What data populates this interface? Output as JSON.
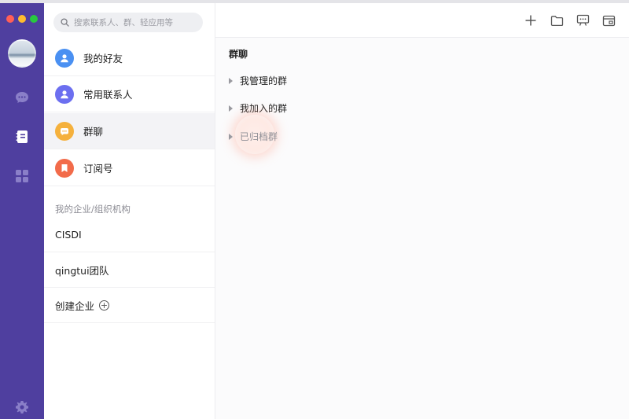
{
  "search": {
    "placeholder": "搜索联系人、群、轻应用等"
  },
  "rail": {
    "items": [
      {
        "name": "chat",
        "icon": "chat-bubble-icon"
      },
      {
        "name": "contacts",
        "icon": "contacts-book-icon",
        "active": true
      },
      {
        "name": "apps",
        "icon": "grid-icon"
      }
    ],
    "settings_icon": "gear-icon"
  },
  "sidebar": {
    "items": [
      {
        "label": "我的好友",
        "icon": "person-icon",
        "color": "#4a90f2"
      },
      {
        "label": "常用联系人",
        "icon": "person-icon",
        "color": "#6c6ff0"
      },
      {
        "label": "群聊",
        "icon": "group-chat-icon",
        "color": "#f5b13d",
        "active": true
      },
      {
        "label": "订阅号",
        "icon": "bookmark-icon",
        "color": "#f26b4a"
      }
    ],
    "org_section_title": "我的企业/组织机构",
    "orgs": [
      {
        "label": "CISDI"
      },
      {
        "label": "qingtui团队"
      }
    ],
    "create_org_label": "创建企业"
  },
  "toolbar": {
    "icons": [
      "plus-icon",
      "folder-icon",
      "presentation-icon",
      "window-icon"
    ]
  },
  "main": {
    "title": "群聊",
    "groups": [
      {
        "label": "我管理的群"
      },
      {
        "label": "我加入的群"
      },
      {
        "label": "已归档群"
      }
    ]
  },
  "colors": {
    "rail_bg": "#4f3f9f",
    "accent_highlight": "#ffd7cc"
  }
}
